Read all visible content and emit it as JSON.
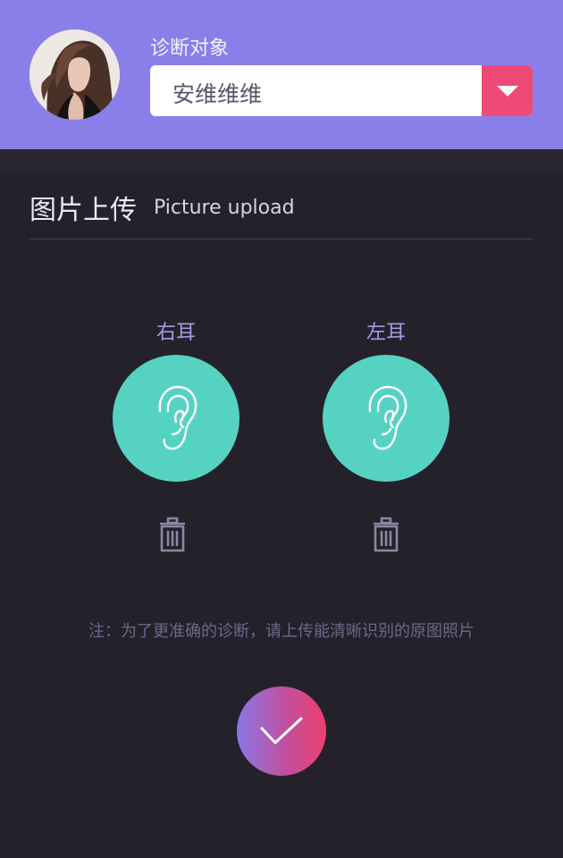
{
  "header": {
    "label": "诊断对象",
    "selected_patient": "安维维维",
    "dropdown_icon": "caret-down-icon",
    "accent_color": "#ee4a76",
    "bg_color": "#8a7fe8"
  },
  "upload": {
    "title": "图片上传",
    "subtitle": "Picture upload"
  },
  "ears": [
    {
      "label": "右耳",
      "icon": "ear-icon",
      "delete_icon": "trash-icon"
    },
    {
      "label": "左耳",
      "icon": "ear-icon",
      "delete_icon": "trash-icon"
    }
  ],
  "note": "注：为了更准确的诊断，请上传能清晰识别的原图照片",
  "confirm": {
    "icon": "checkmark-icon"
  },
  "colors": {
    "ear_circle": "#56d2c3",
    "background": "#25212b"
  }
}
